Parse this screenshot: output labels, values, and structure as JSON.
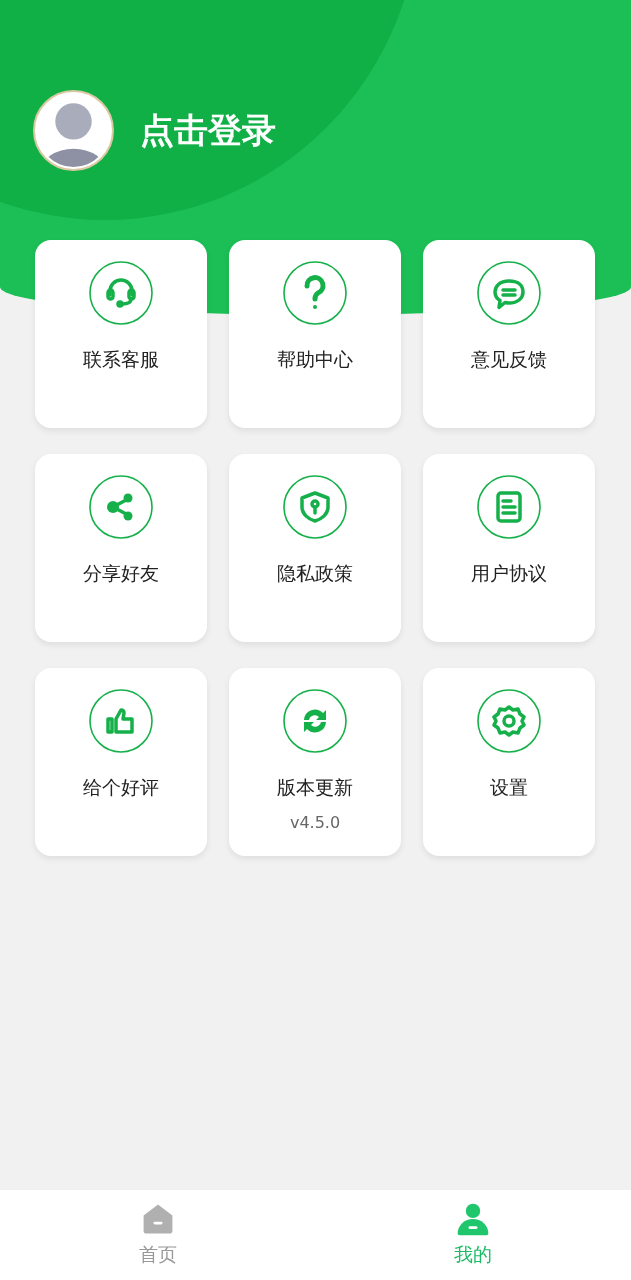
{
  "profile": {
    "login_label": "点击登录"
  },
  "menu": [
    {
      "label": "联系客服"
    },
    {
      "label": "帮助中心"
    },
    {
      "label": "意见反馈"
    },
    {
      "label": "分享好友"
    },
    {
      "label": "隐私政策"
    },
    {
      "label": "用户协议"
    },
    {
      "label": "给个好评"
    },
    {
      "label": "版本更新",
      "version": "v4.5.0"
    },
    {
      "label": "设置"
    }
  ],
  "tab_bar": [
    {
      "label": "首页",
      "selected": false
    },
    {
      "label": "我的",
      "selected": true
    }
  ]
}
